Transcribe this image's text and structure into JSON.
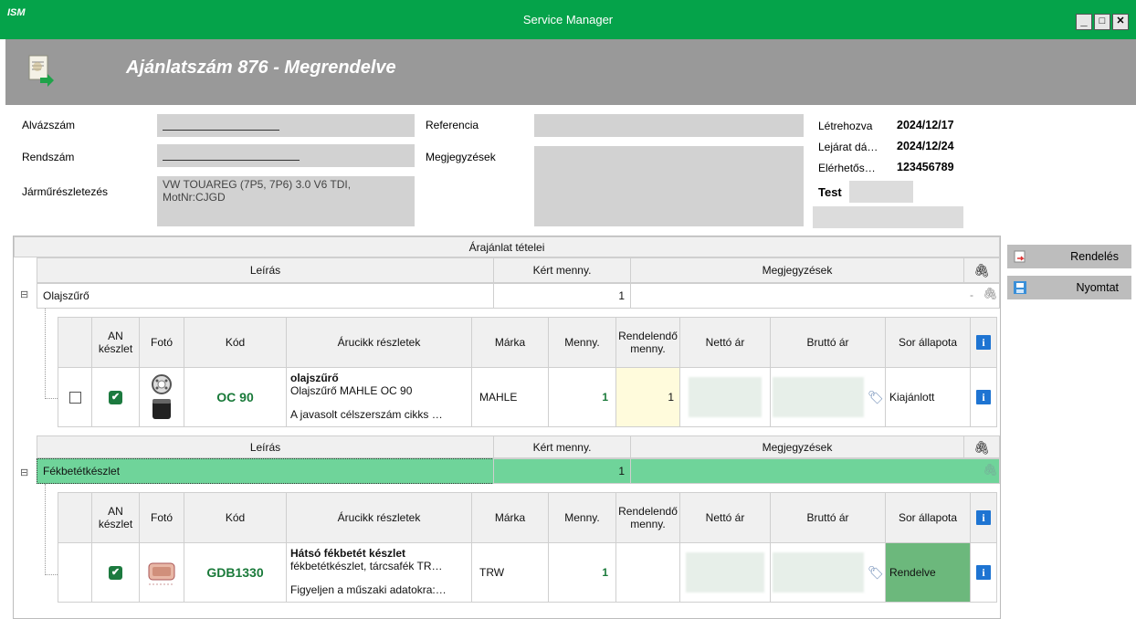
{
  "window": {
    "title": "Service Manager",
    "logo": "ISM",
    "min": "_",
    "max": "□",
    "close": "✕"
  },
  "header": {
    "title": "Ajánlatszám 876 - Megrendelve",
    "icon": "document-icon"
  },
  "form": {
    "chassis_label": "Alvázszám",
    "plate_label": "Rendszám",
    "vehicle_label": "Járműrészletezés",
    "vehicle_value": "VW TOUAREG (7P5, 7P6) 3.0 V6 TDI, MotNr:CJGD",
    "reference_label": "Referencia",
    "notes_label": "Megjegyzések",
    "created_label": "Létrehozva",
    "created_value": "2024/12/17",
    "expiry_label": "Lejárat dá…",
    "expiry_value": "2024/12/24",
    "contact_label": "Elérhetős…",
    "contact_value": "123456789",
    "customer_label": "Test"
  },
  "grid": {
    "title": "Árajánlat tételei",
    "group_headers": {
      "description": "Leírás",
      "requested_qty": "Kért menny.",
      "notes": "Megjegyzések"
    },
    "detail_headers": {
      "an_stock": "AN készlet",
      "photo": "Fotó",
      "code": "Kód",
      "details": "Árucikk részletek",
      "brand": "Márka",
      "qty": "Menny.",
      "ordered_qty": "Rendelendő menny.",
      "net": "Nettó ár",
      "gross": "Bruttó ár",
      "status": "Sor állapota"
    },
    "groups": [
      {
        "expander": "⊟",
        "name": "Olajszűrő",
        "requested_qty": "1",
        "notes_suffix": "-",
        "item": {
          "code": "OC 90",
          "title": "olajszűrő",
          "subtitle": "Olajszűrő MAHLE OC 90",
          "note": "A javasolt célszerszám cikks …",
          "brand": "MAHLE",
          "qty": "1",
          "ordered_qty": "1",
          "status": "Kiajánlott"
        }
      },
      {
        "expander": "⊟",
        "name": "Fékbetétkészlet",
        "requested_qty": "1",
        "item": {
          "code": "GDB1330",
          "title": "Hátsó fékbetét készlet",
          "subtitle": "fékbetétkészlet, tárcsafék TR…",
          "note": "Figyeljen a műszaki adatokra:…",
          "brand": "TRW",
          "qty": "1",
          "ordered_qty": "",
          "status": "Rendelve"
        }
      }
    ]
  },
  "side_buttons": {
    "order": "Rendelés",
    "print": "Nyomtat"
  },
  "colors": {
    "title_green": "#05a34a",
    "header_gray": "#999999",
    "selected_row": "#6fd49a",
    "ordered_status": "#6cb87c",
    "link_green": "#1a7a3a"
  }
}
